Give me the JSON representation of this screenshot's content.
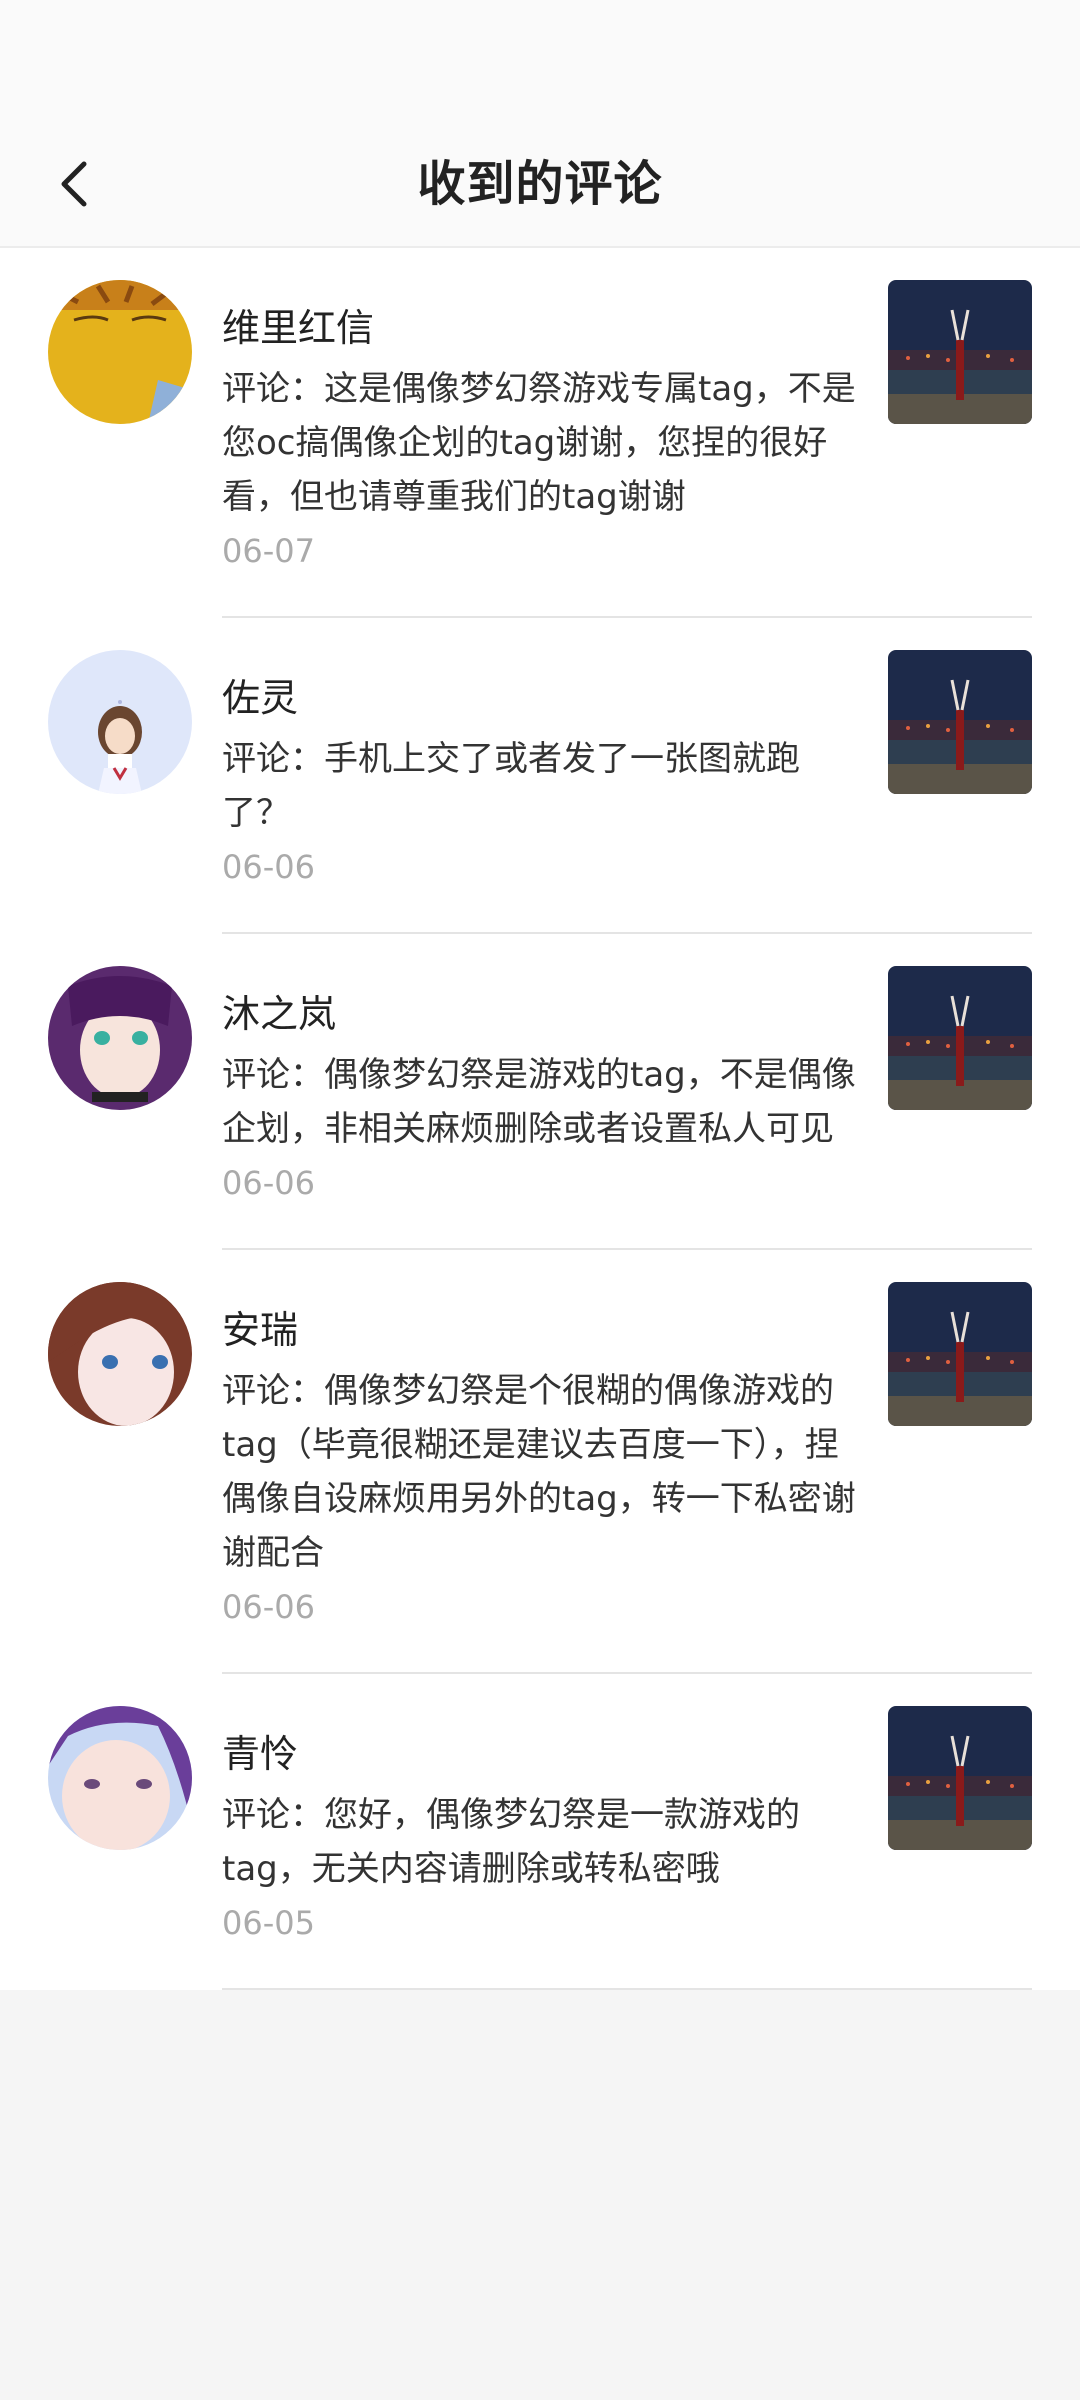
{
  "header": {
    "title": "收到的评论",
    "back_icon": "back-arrow-icon"
  },
  "comments": [
    {
      "name": "维里红信",
      "comment": "评论：这是偶像梦幻祭游戏专属tag，不是您oc搞偶像企划的tag谢谢，您捏的很好看，但也请尊重我们的tag谢谢",
      "date": "06-07",
      "avatar_color": "#e0b020"
    },
    {
      "name": "佐灵",
      "comment": "评论：手机上交了或者发了一张图就跑了？",
      "date": "06-06",
      "avatar_color": "#dfe8fb"
    },
    {
      "name": "沐之岚",
      "comment": "评论：偶像梦幻祭是游戏的tag，不是偶像企划，非相关麻烦删除或者设置私人可见",
      "date": "06-06",
      "avatar_color": "#5a2a6e"
    },
    {
      "name": "安瑞",
      "comment": "评论：偶像梦幻祭是个很糊的偶像游戏的tag（毕竟很糊还是建议去百度一下），捏偶像自设麻烦用另外的tag，转一下私密谢谢配合",
      "date": "06-06",
      "avatar_color": "#7a3a2a"
    },
    {
      "name": "青怜",
      "comment": "评论：您好，偶像梦幻祭是一款游戏的tag，无关内容请删除或转私密哦",
      "date": "06-05",
      "avatar_color": "#6a3e9a"
    }
  ]
}
